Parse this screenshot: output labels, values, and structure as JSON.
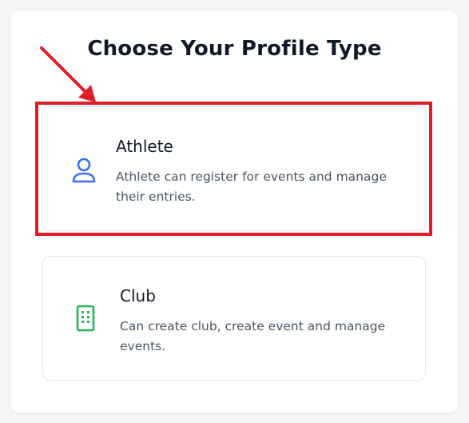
{
  "page": {
    "title": "Choose Your Profile Type"
  },
  "options": [
    {
      "title": "Athlete",
      "description": "Athlete can register for events and manage their entries.",
      "icon": "user-icon",
      "icon_color": "#3b6ff2",
      "selected": true
    },
    {
      "title": "Club",
      "description": "Can create club, create event and manage events.",
      "icon": "building-icon",
      "icon_color": "#22b55a",
      "selected": false
    }
  ],
  "annotation": {
    "highlight_color": "#e11d27"
  }
}
